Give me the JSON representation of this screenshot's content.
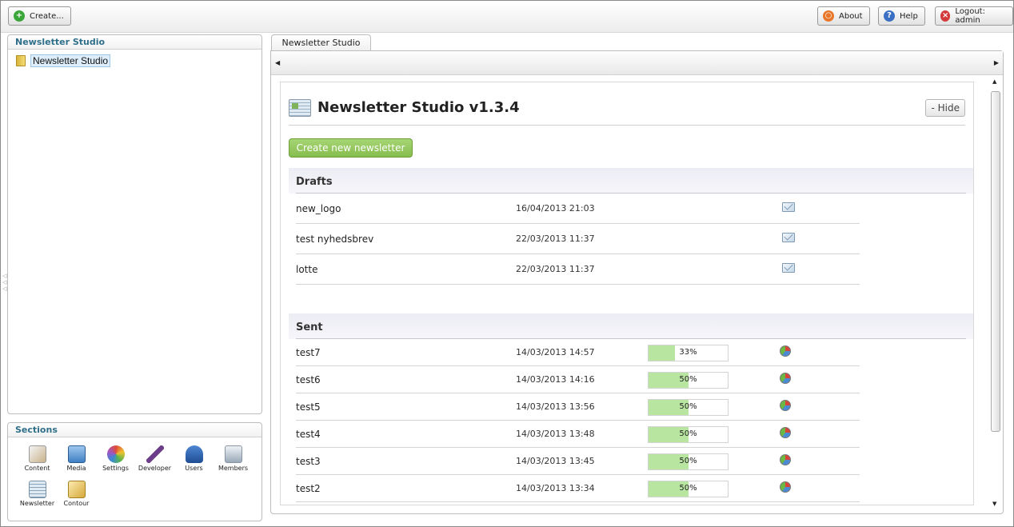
{
  "toolbar": {
    "create_label": "Create...",
    "about_label": "About",
    "help_label": "Help",
    "logout_label": "Logout: admin"
  },
  "tree": {
    "title": "Newsletter Studio",
    "root_label": "Newsletter Studio"
  },
  "sections": {
    "title": "Sections",
    "items": [
      {
        "label": "Content",
        "icon": "content-icon",
        "color": "#c8b28a"
      },
      {
        "label": "Media",
        "icon": "media-icon",
        "color": "#3f7fc4"
      },
      {
        "label": "Settings",
        "icon": "settings-icon",
        "color": "#e0a030"
      },
      {
        "label": "Developer",
        "icon": "developer-icon",
        "color": "#6a3c8a"
      },
      {
        "label": "Users",
        "icon": "users-icon",
        "color": "#2b5fa8"
      },
      {
        "label": "Members",
        "icon": "members-icon",
        "color": "#9aa8b8"
      },
      {
        "label": "Newsletter",
        "icon": "newsletter-icon",
        "color": "#8aa6bd"
      },
      {
        "label": "Contour",
        "icon": "contour-icon",
        "color": "#d6a93a"
      }
    ]
  },
  "tab": {
    "label": "Newsletter Studio"
  },
  "main": {
    "title": "Newsletter Studio v1.3.4",
    "hide_label": "- Hide",
    "create_button": "Create new newsletter",
    "drafts_heading": "Drafts",
    "sent_heading": "Sent",
    "drafts": [
      {
        "name": "new_logo",
        "date": "16/04/2013 21:03"
      },
      {
        "name": "test nyhedsbrev",
        "date": "22/03/2013 11:37"
      },
      {
        "name": "lotte",
        "date": "22/03/2013 11:37"
      }
    ],
    "sent": [
      {
        "name": "test7",
        "date": "14/03/2013 14:57",
        "progress": 33,
        "progress_label": "33%"
      },
      {
        "name": "test6",
        "date": "14/03/2013 14:16",
        "progress": 50,
        "progress_label": "50%"
      },
      {
        "name": "test5",
        "date": "14/03/2013 13:56",
        "progress": 50,
        "progress_label": "50%"
      },
      {
        "name": "test4",
        "date": "14/03/2013 13:48",
        "progress": 50,
        "progress_label": "50%"
      },
      {
        "name": "test3",
        "date": "14/03/2013 13:45",
        "progress": 50,
        "progress_label": "50%"
      },
      {
        "name": "test2",
        "date": "14/03/2013 13:34",
        "progress": 50,
        "progress_label": "50%"
      }
    ]
  }
}
